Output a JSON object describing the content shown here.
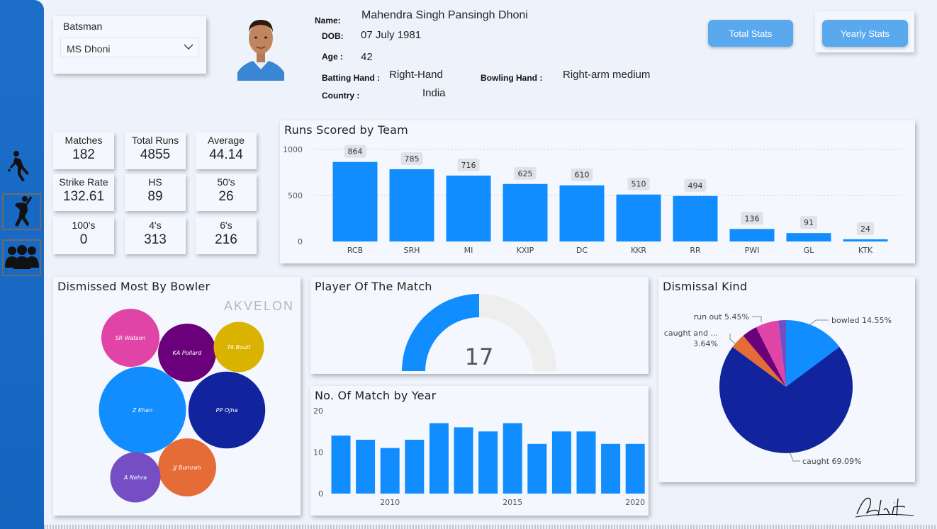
{
  "sidebar": {
    "items": [
      {
        "name": "batsman-icon",
        "active": false
      },
      {
        "name": "bowler-icon",
        "active": true
      },
      {
        "name": "team-icon",
        "active": true
      }
    ]
  },
  "slicer": {
    "label": "Batsman",
    "value": "MS Dhoni"
  },
  "player": {
    "name_label": "Name:",
    "name": "Mahendra Singh Pansingh Dhoni",
    "dob_label": "DOB:",
    "dob": "07 July 1981",
    "age_label": "Age :",
    "age": "42",
    "batting_label": "Batting Hand :",
    "batting": "Right-Hand",
    "bowling_label": "Bowling Hand :",
    "bowling": "Right-arm medium",
    "country_label": "Country :",
    "country": "India"
  },
  "buttons": {
    "total_stats": "Total Stats",
    "yearly_stats": "Yearly Stats"
  },
  "kpis": [
    {
      "label": "Matches",
      "value": "182"
    },
    {
      "label": "Total Runs",
      "value": "4855"
    },
    {
      "label": "Average",
      "value": "44.14"
    },
    {
      "label": "Strike Rate",
      "value": "132.61"
    },
    {
      "label": "HS",
      "value": "89"
    },
    {
      "label": "50's",
      "value": "26"
    },
    {
      "label": "100's",
      "value": "0"
    },
    {
      "label": "4's",
      "value": "313"
    },
    {
      "label": "6's",
      "value": "216"
    }
  ],
  "colors": {
    "accent": "#118dff",
    "sidebar": "#1565c0",
    "button": "#5aa8ee"
  },
  "watermark": "AKVELON",
  "chart_data": [
    {
      "id": "runs_by_team",
      "type": "bar",
      "title": "Runs Scored by Team",
      "categories": [
        "RCB",
        "SRH",
        "MI",
        "KXIP",
        "DC",
        "KKR",
        "RR",
        "PWI",
        "GL",
        "KTK"
      ],
      "values": [
        864,
        785,
        716,
        625,
        610,
        510,
        494,
        136,
        91,
        24
      ],
      "yticks": [
        0,
        500,
        1000
      ],
      "ylim": [
        0,
        1000
      ],
      "grid": true,
      "data_labels": true,
      "color": "#118dff"
    },
    {
      "id": "dismissed_by_bowler",
      "type": "bubble",
      "title": "Dismissed Most By Bowler",
      "items": [
        {
          "name": "SR Watson",
          "value": 4,
          "color": "#e044a7"
        },
        {
          "name": "KA Pollard",
          "value": 4,
          "color": "#6b007b"
        },
        {
          "name": "TA Boult",
          "value": 3,
          "color": "#d9b300"
        },
        {
          "name": "Z Khan",
          "value": 9,
          "color": "#118dff"
        },
        {
          "name": "PP Ojha",
          "value": 7,
          "color": "#12239e"
        },
        {
          "name": "JJ Bumrah",
          "value": 4,
          "color": "#e66c37"
        },
        {
          "name": "A Nehra",
          "value": 3,
          "color": "#744ec2"
        }
      ]
    },
    {
      "id": "player_of_match",
      "type": "gauge",
      "title": "Player Of The Match",
      "value": 17,
      "label": "17",
      "max": 34,
      "color": "#118dff"
    },
    {
      "id": "matches_by_year",
      "type": "bar",
      "title": "No. Of Match by Year",
      "x": [
        2008,
        2009,
        2010,
        2011,
        2012,
        2013,
        2014,
        2015,
        2016,
        2017,
        2018,
        2019,
        2020
      ],
      "values": [
        14,
        13,
        11,
        13,
        17,
        16,
        15,
        17,
        12,
        15,
        15,
        12,
        12
      ],
      "xticks": [
        "2010",
        "2015",
        "2020"
      ],
      "yticks": [
        0,
        10,
        20
      ],
      "ylim": [
        0,
        20
      ],
      "color": "#118dff"
    },
    {
      "id": "dismissal_kind",
      "type": "pie",
      "title": "Dismissal Kind",
      "slices": [
        {
          "name": "bowled",
          "value": 14.55,
          "label": "bowled 14.55%",
          "color": "#118dff"
        },
        {
          "name": "caught",
          "value": 69.09,
          "label": "caught 69.09%",
          "color": "#12239e"
        },
        {
          "name": "caught and bowled",
          "value": 3.64,
          "label": "caught and ...",
          "label2": "3.64%",
          "color": "#e66c37"
        },
        {
          "name": "other-1",
          "value": 3.64,
          "color": "#6b007b"
        },
        {
          "name": "run out",
          "value": 5.45,
          "label": "run out 5.45%",
          "color": "#e044a7"
        },
        {
          "name": "other-2",
          "value": 1.82,
          "color": "#744ec2"
        }
      ]
    }
  ]
}
